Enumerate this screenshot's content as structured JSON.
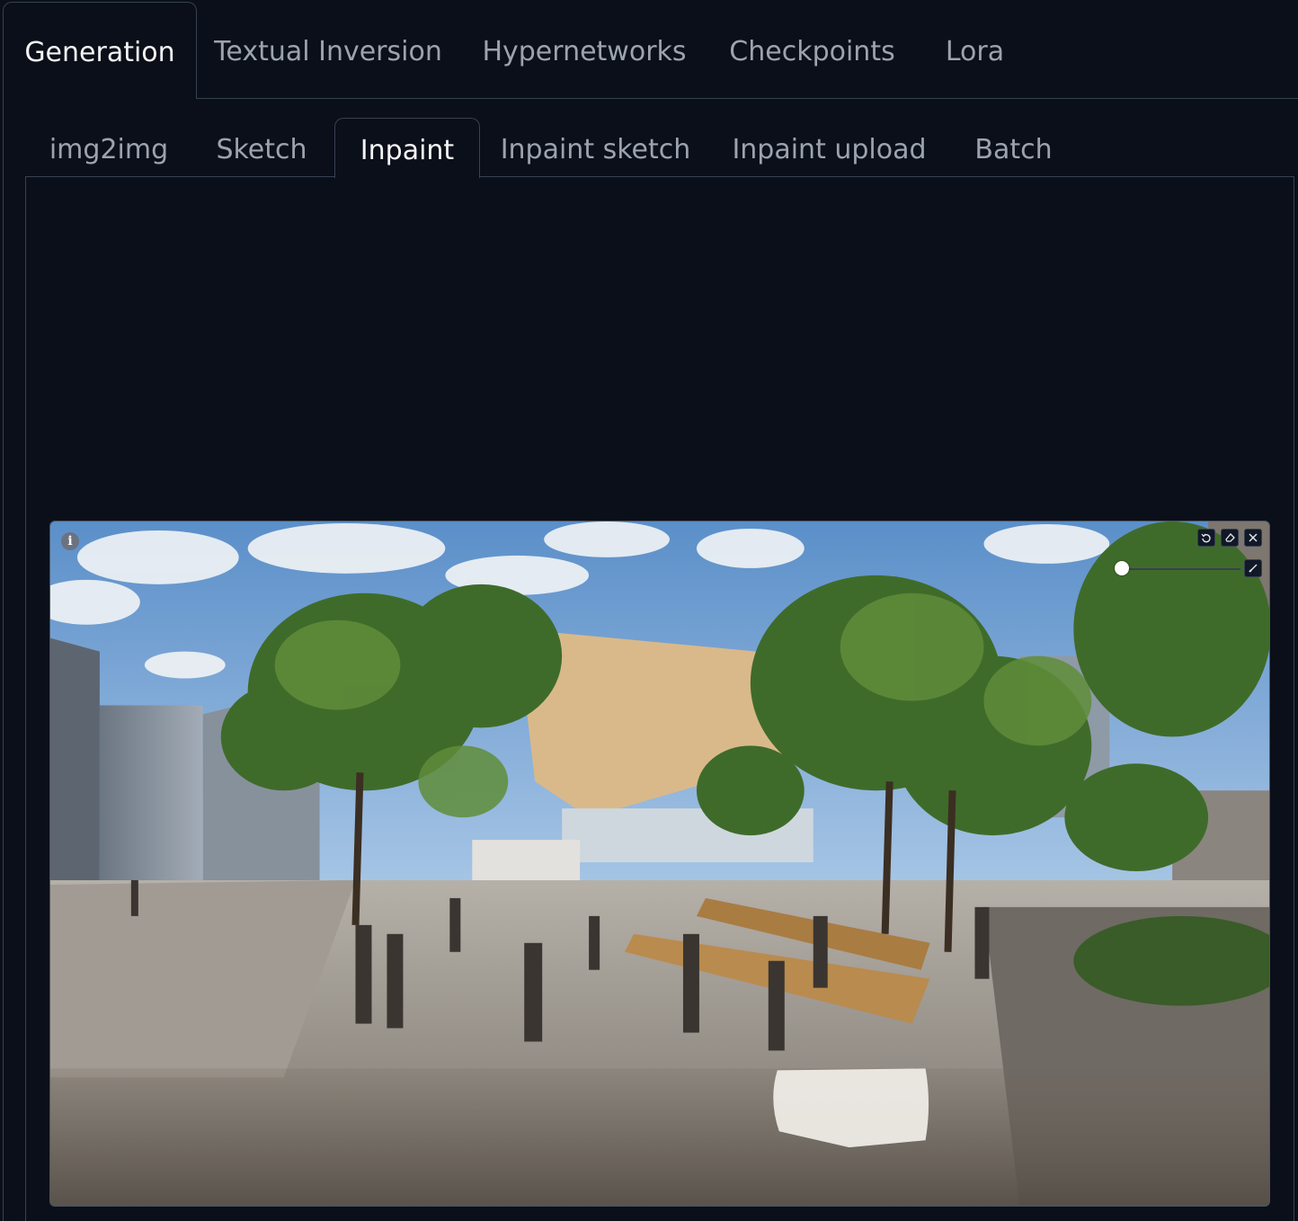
{
  "main_tabs": [
    {
      "label": "Generation",
      "active": true
    },
    {
      "label": "Textual Inversion",
      "active": false
    },
    {
      "label": "Hypernetworks",
      "active": false
    },
    {
      "label": "Checkpoints",
      "active": false
    },
    {
      "label": "Lora",
      "active": false
    }
  ],
  "sub_tabs": [
    {
      "label": "img2img",
      "active": false
    },
    {
      "label": "Sketch",
      "active": false
    },
    {
      "label": "Inpaint",
      "active": true
    },
    {
      "label": "Inpaint sketch",
      "active": false
    },
    {
      "label": "Inpaint upload",
      "active": false
    },
    {
      "label": "Batch",
      "active": false
    }
  ],
  "editor": {
    "info_icon": "info-icon",
    "tools": [
      "undo-icon",
      "eraser-icon",
      "close-icon",
      "brush-icon"
    ],
    "brush_size_fraction": 0.0
  },
  "colors": {
    "background": "#0b0f19",
    "border": "#374151",
    "active_text": "#f3f4f6",
    "inactive_text": "#9ca3af"
  }
}
